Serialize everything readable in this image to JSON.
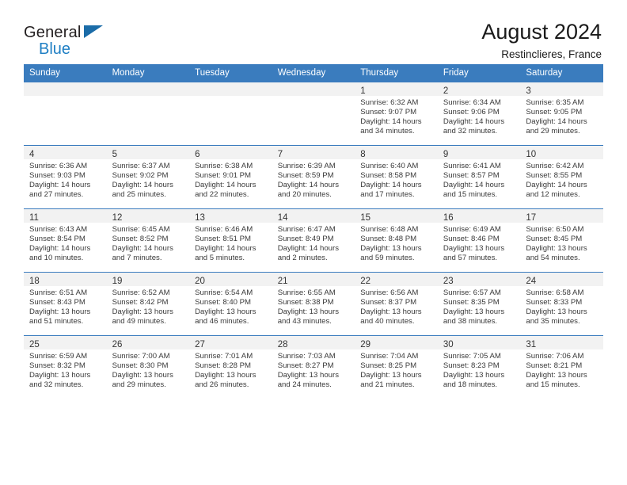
{
  "brand": {
    "line1": "General",
    "line2": "Blue",
    "flag_icon": "triangle-flag-icon",
    "accent_color": "#1f7fc4"
  },
  "header": {
    "title": "August 2024",
    "subtitle": "Restinclieres, France"
  },
  "theme": {
    "header_row_bg": "#3a7cbe",
    "daynum_band_bg": "#f2f2f2",
    "grid_line": "#3a7cbe",
    "text": "#3a3a3a"
  },
  "calendar": {
    "weekday_headers": [
      "Sunday",
      "Monday",
      "Tuesday",
      "Wednesday",
      "Thursday",
      "Friday",
      "Saturday"
    ],
    "weeks": [
      [
        {
          "day": "",
          "lines": []
        },
        {
          "day": "",
          "lines": []
        },
        {
          "day": "",
          "lines": []
        },
        {
          "day": "",
          "lines": []
        },
        {
          "day": "1",
          "lines": [
            "Sunrise: 6:32 AM",
            "Sunset: 9:07 PM",
            "Daylight: 14 hours",
            "and 34 minutes."
          ]
        },
        {
          "day": "2",
          "lines": [
            "Sunrise: 6:34 AM",
            "Sunset: 9:06 PM",
            "Daylight: 14 hours",
            "and 32 minutes."
          ]
        },
        {
          "day": "3",
          "lines": [
            "Sunrise: 6:35 AM",
            "Sunset: 9:05 PM",
            "Daylight: 14 hours",
            "and 29 minutes."
          ]
        }
      ],
      [
        {
          "day": "4",
          "lines": [
            "Sunrise: 6:36 AM",
            "Sunset: 9:03 PM",
            "Daylight: 14 hours",
            "and 27 minutes."
          ]
        },
        {
          "day": "5",
          "lines": [
            "Sunrise: 6:37 AM",
            "Sunset: 9:02 PM",
            "Daylight: 14 hours",
            "and 25 minutes."
          ]
        },
        {
          "day": "6",
          "lines": [
            "Sunrise: 6:38 AM",
            "Sunset: 9:01 PM",
            "Daylight: 14 hours",
            "and 22 minutes."
          ]
        },
        {
          "day": "7",
          "lines": [
            "Sunrise: 6:39 AM",
            "Sunset: 8:59 PM",
            "Daylight: 14 hours",
            "and 20 minutes."
          ]
        },
        {
          "day": "8",
          "lines": [
            "Sunrise: 6:40 AM",
            "Sunset: 8:58 PM",
            "Daylight: 14 hours",
            "and 17 minutes."
          ]
        },
        {
          "day": "9",
          "lines": [
            "Sunrise: 6:41 AM",
            "Sunset: 8:57 PM",
            "Daylight: 14 hours",
            "and 15 minutes."
          ]
        },
        {
          "day": "10",
          "lines": [
            "Sunrise: 6:42 AM",
            "Sunset: 8:55 PM",
            "Daylight: 14 hours",
            "and 12 minutes."
          ]
        }
      ],
      [
        {
          "day": "11",
          "lines": [
            "Sunrise: 6:43 AM",
            "Sunset: 8:54 PM",
            "Daylight: 14 hours",
            "and 10 minutes."
          ]
        },
        {
          "day": "12",
          "lines": [
            "Sunrise: 6:45 AM",
            "Sunset: 8:52 PM",
            "Daylight: 14 hours",
            "and 7 minutes."
          ]
        },
        {
          "day": "13",
          "lines": [
            "Sunrise: 6:46 AM",
            "Sunset: 8:51 PM",
            "Daylight: 14 hours",
            "and 5 minutes."
          ]
        },
        {
          "day": "14",
          "lines": [
            "Sunrise: 6:47 AM",
            "Sunset: 8:49 PM",
            "Daylight: 14 hours",
            "and 2 minutes."
          ]
        },
        {
          "day": "15",
          "lines": [
            "Sunrise: 6:48 AM",
            "Sunset: 8:48 PM",
            "Daylight: 13 hours",
            "and 59 minutes."
          ]
        },
        {
          "day": "16",
          "lines": [
            "Sunrise: 6:49 AM",
            "Sunset: 8:46 PM",
            "Daylight: 13 hours",
            "and 57 minutes."
          ]
        },
        {
          "day": "17",
          "lines": [
            "Sunrise: 6:50 AM",
            "Sunset: 8:45 PM",
            "Daylight: 13 hours",
            "and 54 minutes."
          ]
        }
      ],
      [
        {
          "day": "18",
          "lines": [
            "Sunrise: 6:51 AM",
            "Sunset: 8:43 PM",
            "Daylight: 13 hours",
            "and 51 minutes."
          ]
        },
        {
          "day": "19",
          "lines": [
            "Sunrise: 6:52 AM",
            "Sunset: 8:42 PM",
            "Daylight: 13 hours",
            "and 49 minutes."
          ]
        },
        {
          "day": "20",
          "lines": [
            "Sunrise: 6:54 AM",
            "Sunset: 8:40 PM",
            "Daylight: 13 hours",
            "and 46 minutes."
          ]
        },
        {
          "day": "21",
          "lines": [
            "Sunrise: 6:55 AM",
            "Sunset: 8:38 PM",
            "Daylight: 13 hours",
            "and 43 minutes."
          ]
        },
        {
          "day": "22",
          "lines": [
            "Sunrise: 6:56 AM",
            "Sunset: 8:37 PM",
            "Daylight: 13 hours",
            "and 40 minutes."
          ]
        },
        {
          "day": "23",
          "lines": [
            "Sunrise: 6:57 AM",
            "Sunset: 8:35 PM",
            "Daylight: 13 hours",
            "and 38 minutes."
          ]
        },
        {
          "day": "24",
          "lines": [
            "Sunrise: 6:58 AM",
            "Sunset: 8:33 PM",
            "Daylight: 13 hours",
            "and 35 minutes."
          ]
        }
      ],
      [
        {
          "day": "25",
          "lines": [
            "Sunrise: 6:59 AM",
            "Sunset: 8:32 PM",
            "Daylight: 13 hours",
            "and 32 minutes."
          ]
        },
        {
          "day": "26",
          "lines": [
            "Sunrise: 7:00 AM",
            "Sunset: 8:30 PM",
            "Daylight: 13 hours",
            "and 29 minutes."
          ]
        },
        {
          "day": "27",
          "lines": [
            "Sunrise: 7:01 AM",
            "Sunset: 8:28 PM",
            "Daylight: 13 hours",
            "and 26 minutes."
          ]
        },
        {
          "day": "28",
          "lines": [
            "Sunrise: 7:03 AM",
            "Sunset: 8:27 PM",
            "Daylight: 13 hours",
            "and 24 minutes."
          ]
        },
        {
          "day": "29",
          "lines": [
            "Sunrise: 7:04 AM",
            "Sunset: 8:25 PM",
            "Daylight: 13 hours",
            "and 21 minutes."
          ]
        },
        {
          "day": "30",
          "lines": [
            "Sunrise: 7:05 AM",
            "Sunset: 8:23 PM",
            "Daylight: 13 hours",
            "and 18 minutes."
          ]
        },
        {
          "day": "31",
          "lines": [
            "Sunrise: 7:06 AM",
            "Sunset: 8:21 PM",
            "Daylight: 13 hours",
            "and 15 minutes."
          ]
        }
      ]
    ]
  }
}
